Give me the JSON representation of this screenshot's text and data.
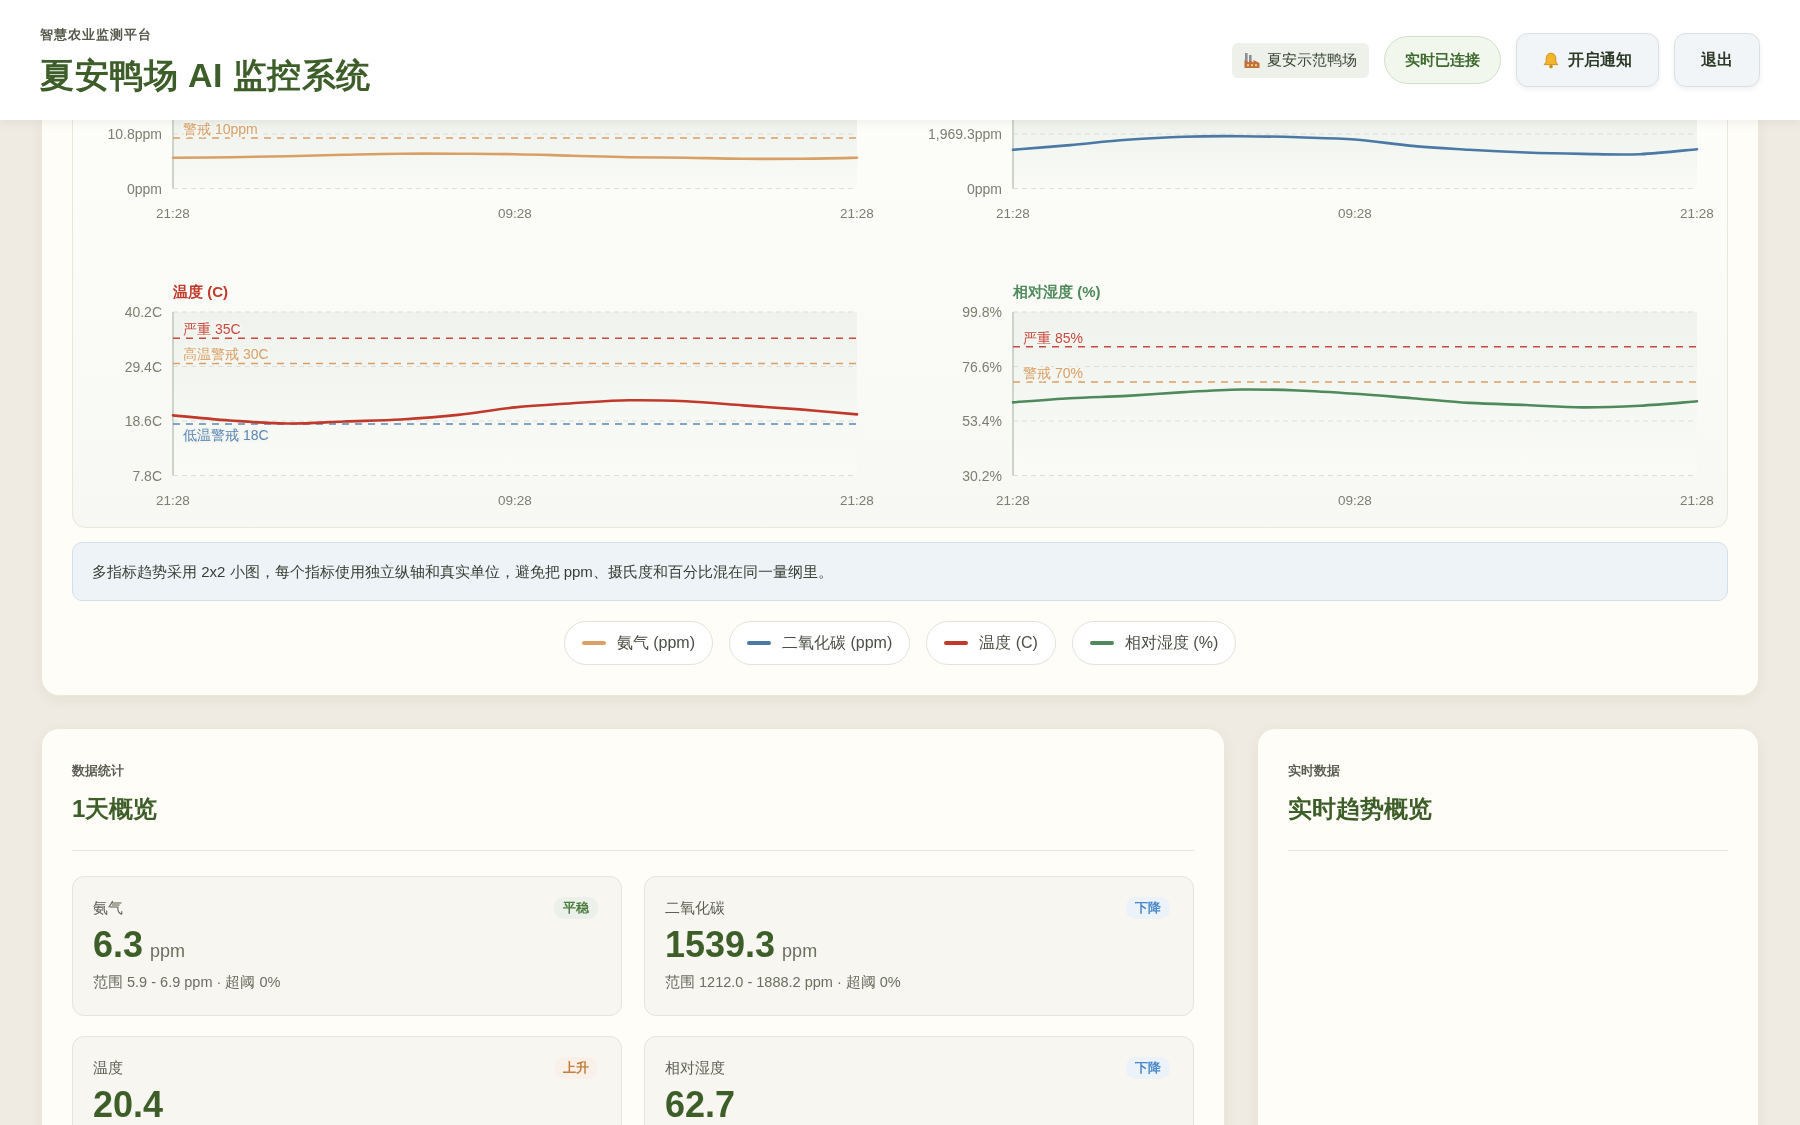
{
  "header": {
    "subtitle": "智慧农业监测平台",
    "title": "夏安鸭场 AI 监控系统",
    "farm": "夏安示范鸭场",
    "connection": {
      "label": "实时已连接",
      "connected": true
    },
    "buttons": [
      {
        "label": "开启通知",
        "kind": "notify"
      },
      {
        "label": "退出",
        "kind": "logout"
      }
    ]
  },
  "trend_panel": {
    "charts": [
      {
        "chart_data": {
          "type": "line",
          "categories": [
            "21:28",
            null,
            null,
            null,
            null,
            null,
            "09:28",
            null,
            null,
            null,
            null,
            null,
            "21:28"
          ],
          "series": [
            {
              "name": "氨气 (ppm)",
              "color": "#d9a066",
              "values": [
                6.1,
                6.2,
                6.4,
                6.7,
                6.9,
                6.9,
                6.8,
                6.5,
                6.2,
                6.1,
                5.9,
                5.9,
                6.1
              ]
            }
          ],
          "ylim": [
            0,
            10.8
          ],
          "yticks": [
            {
              "value": 0,
              "label": "0ppm"
            },
            {
              "value": 10.8,
              "label": "10.8ppm"
            }
          ],
          "ref_lines": [
            {
              "axis": "y",
              "value": 10,
              "label": "警戒 10ppm",
              "color": "#d9a066"
            }
          ]
        }
      },
      {
        "chart_data": {
          "type": "line",
          "categories": [
            "21:28",
            null,
            null,
            null,
            null,
            null,
            "09:28",
            null,
            null,
            null,
            null,
            null,
            "21:28"
          ],
          "series": [
            {
              "name": "二氧化碳 (ppm)",
              "color": "#4a79a5",
              "values": [
                1400,
                1570,
                1760,
                1870,
                1890,
                1850,
                1770,
                1540,
                1400,
                1300,
                1250,
                1240,
                1420
              ]
            }
          ],
          "ylim": [
            0,
            1969.3
          ],
          "yticks": [
            {
              "value": 0,
              "label": "0ppm"
            },
            {
              "value": 1969.3,
              "label": "1,969.3ppm"
            }
          ]
        }
      },
      {
        "chart_data": {
          "type": "line",
          "title": "温度 (C)",
          "categories": [
            "21:28",
            null,
            null,
            null,
            null,
            null,
            "09:28",
            null,
            null,
            null,
            null,
            null,
            "21:28"
          ],
          "series": [
            {
              "name": "温度 (C)",
              "color": "#c0392b",
              "values": [
                19.7,
                18.7,
                18.1,
                18.5,
                18.9,
                19.8,
                21.3,
                22.1,
                22.7,
                22.5,
                21.7,
                20.9,
                19.9
              ]
            }
          ],
          "ylim": [
            7.8,
            40.2
          ],
          "yticks": [
            {
              "value": 7.8,
              "label": "7.8C"
            },
            {
              "value": 18.6,
              "label": "18.6C"
            },
            {
              "value": 29.4,
              "label": "29.4C"
            },
            {
              "value": 40.2,
              "label": "40.2C"
            }
          ],
          "ref_lines": [
            {
              "axis": "y",
              "value": 35,
              "label": "严重 35C",
              "color": "#c8493f"
            },
            {
              "axis": "y",
              "value": 30,
              "label": "高温警戒 30C",
              "color": "#d9a066"
            },
            {
              "axis": "y",
              "value": 18,
              "label": "低温警戒 18C",
              "color": "#5b86b5"
            }
          ]
        }
      },
      {
        "chart_data": {
          "type": "line",
          "title": "相对湿度 (%)",
          "categories": [
            "21:28",
            null,
            null,
            null,
            null,
            null,
            "09:28",
            null,
            null,
            null,
            null,
            null,
            "21:28"
          ],
          "series": [
            {
              "name": "相对湿度 (%)",
              "color": "#4e8a5c",
              "values": [
                61.3,
                63.1,
                64.1,
                65.7,
                66.8,
                66.4,
                65.0,
                63.1,
                61.1,
                60.2,
                59.2,
                59.9,
                61.8
              ]
            }
          ],
          "ylim": [
            30.2,
            99.8
          ],
          "yticks": [
            {
              "value": 30.2,
              "label": "30.2%"
            },
            {
              "value": 53.4,
              "label": "53.4%"
            },
            {
              "value": 76.6,
              "label": "76.6%"
            },
            {
              "value": 99.8,
              "label": "99.8%"
            }
          ],
          "ref_lines": [
            {
              "axis": "y",
              "value": 85,
              "label": "严重 85%",
              "color": "#c8493f"
            },
            {
              "axis": "y",
              "value": 70,
              "label": "警戒 70%",
              "color": "#d9a066"
            }
          ]
        }
      }
    ],
    "note": "多指标趋势采用 2x2 小图，每个指标使用独立纵轴和真实单位，避免把 ppm、摄氏度和百分比混在同一量纲里。"
  },
  "stats": {
    "eyebrow": "数据统计",
    "title": "1天概览",
    "cards": [
      {
        "label": "氨气",
        "trend_label": "平稳",
        "color": "#4d7c3f",
        "value": "6.3",
        "unit": "ppm",
        "range": "范围 5.9 - 6.9 ppm · 超阈 0%"
      },
      {
        "label": "二氧化碳",
        "trend_label": "下降",
        "color": "#4a88c7",
        "value": "1539.3",
        "unit": "ppm",
        "range": "范围 1212.0 - 1888.2 ppm · 超阈 0%"
      },
      {
        "label": "温度",
        "trend_label": "上升",
        "color": "#c47f3a",
        "value": "20.4"
      },
      {
        "label": "相对湿度",
        "trend_label": "下降",
        "color": "#4a88c7",
        "value": "62.7"
      }
    ]
  },
  "realtime": {
    "eyebrow": "实时数据",
    "title": "实时趋势概览"
  }
}
